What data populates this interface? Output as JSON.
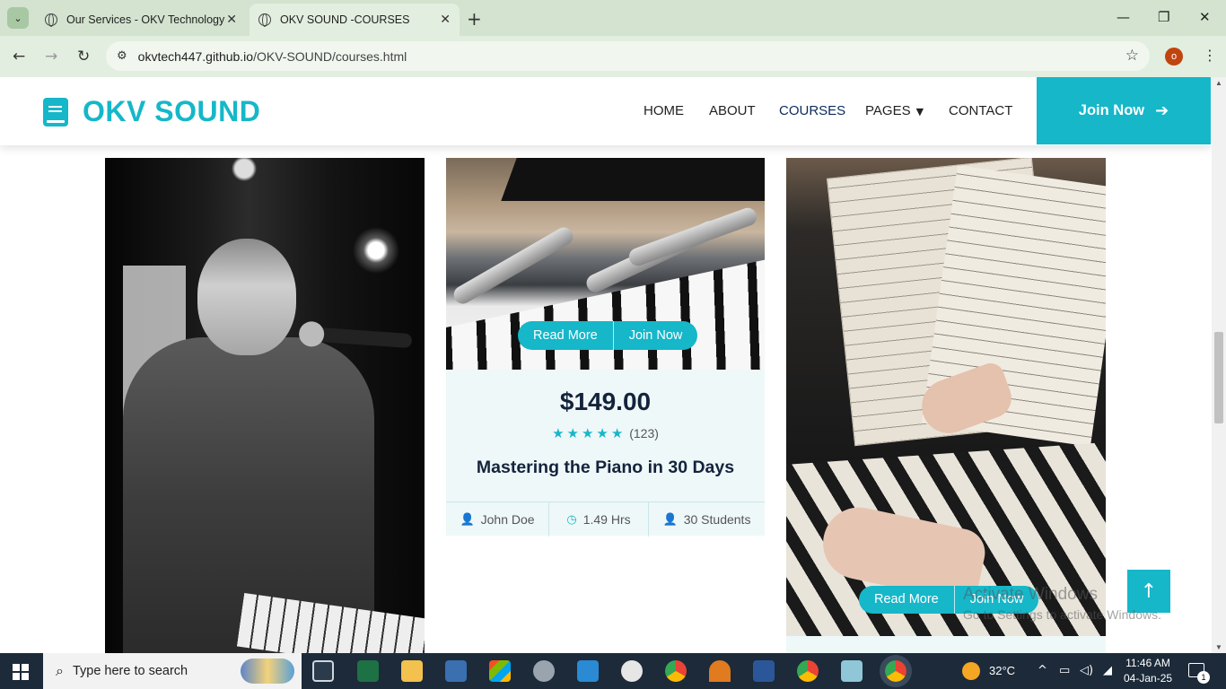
{
  "browser": {
    "tabs": [
      {
        "title": "Our Services - OKV Technology",
        "active": false
      },
      {
        "title": "OKV SOUND -COURSES",
        "active": true
      }
    ],
    "url_host": "okvtech447.github.io",
    "url_path": "/OKV-SOUND/courses.html",
    "profile_initial": "o"
  },
  "site": {
    "brand": "OKV SOUND",
    "nav": {
      "home": "HOME",
      "about": "ABOUT",
      "courses": "COURSES",
      "pages": "PAGES",
      "contact": "CONTACT"
    },
    "join_button": "Join Now",
    "accent_color": "#15b7c9"
  },
  "course_card": {
    "read_more": "Read More",
    "join_now": "Join Now",
    "price": "$149.00",
    "stars": "★★★★★",
    "rating_count": "(123)",
    "title": "Mastering the Piano in 30 Days",
    "instructor": "John Doe",
    "duration": "1.49 Hrs",
    "students": "30 Students"
  },
  "course_card_right": {
    "read_more": "Read More",
    "join_now": "Join Now"
  },
  "watermark": {
    "line1": "Activate Windows",
    "line2": "Go to Settings to activate Windows."
  },
  "taskbar": {
    "search_placeholder": "Type here to search",
    "temperature": "32°C",
    "time": "11:46 AM",
    "date": "04-Jan-25",
    "notification_count": "1"
  }
}
